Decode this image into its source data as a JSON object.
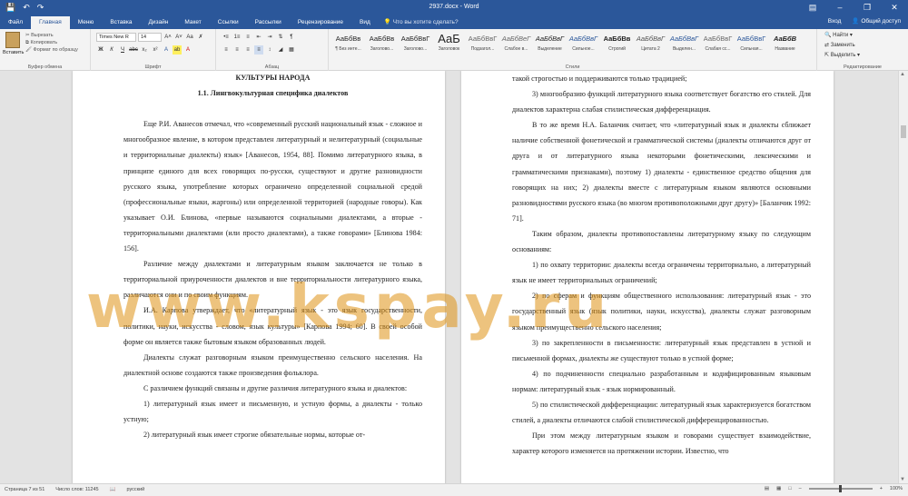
{
  "titlebar": {
    "doc_title": "2937.docx - Word",
    "qat": [
      "save-icon",
      "undo-icon",
      "redo-icon"
    ],
    "controls": [
      "minimize-icon",
      "restore-icon",
      "close-icon"
    ]
  },
  "tabs": [
    "Файл",
    "Главная",
    "Меню",
    "Вставка",
    "Дизайн",
    "Макет",
    "Ссылки",
    "Рассылки",
    "Рецензирование",
    "Вид"
  ],
  "tellme": "Что вы хотите сделать?",
  "tabs_right": {
    "signin": "Вход",
    "share": "Общий доступ"
  },
  "ribbon": {
    "clipboard": {
      "paste": "Вставить",
      "cut": "Вырезать",
      "copy": "Копировать",
      "format_painter": "Формат по образцу",
      "label": "Буфер обмена"
    },
    "font": {
      "name": "Times New R",
      "size": "14",
      "label": "Шрифт"
    },
    "paragraph": {
      "label": "Абзац"
    },
    "styles": {
      "label": "Стили",
      "items": [
        {
          "sample": "АаБбВв",
          "name": "¶ Без инте..."
        },
        {
          "sample": "АаБбВв",
          "name": "Заголово..."
        },
        {
          "sample": "АаБбВвГ",
          "name": "Заголово..."
        },
        {
          "sample": "АаБ",
          "name": "Заголовок"
        },
        {
          "sample": "АаБбВвГ",
          "name": "Подзагол..."
        },
        {
          "sample": "АаБбВеГ",
          "name": "Слабое в..."
        },
        {
          "sample": "АаБбВвГ",
          "name": "Выделение"
        },
        {
          "sample": "АаБбВвГ",
          "name": "Сильное..."
        },
        {
          "sample": "АаБбВв",
          "name": "Строгий"
        },
        {
          "sample": "АаБбВвГ",
          "name": "Цитата 2"
        },
        {
          "sample": "АаБбВвГ",
          "name": "Выделен..."
        },
        {
          "sample": "АаБбВвГ",
          "name": "Слабая сс..."
        },
        {
          "sample": "АаБбВвГ",
          "name": "Сильная..."
        },
        {
          "sample": "АаБбВ",
          "name": "Название"
        }
      ]
    },
    "editing": {
      "find": "Найти",
      "replace": "Заменить",
      "select": "Выделить",
      "label": "Редактирование"
    }
  },
  "page_left": {
    "lines": [
      {
        "text": "КУЛЬТУРЫ НАРОДА",
        "style": "ctr"
      },
      {
        "text": "1.1. Лингвокультурная специфика диалектов",
        "style": "ctr"
      },
      {
        "text": "",
        "style": ""
      },
      {
        "text": "Еще Р.И. Аванесов отмечал, что «современный русский национальный язык - сложное и многообразное явление, в котором представлен литературный и нелитературный (социальные и территориальные диалекты) язык» [Аванесов, 1954, 88]. Помимо литературного языка, в принципе единого для всех говорящих по-русски, существуют и другие разновидности русского языка, употребление которых ограничено определенной социальной средой (профессиональные языки, жаргоны) или определенной территорией (народные говоры). Как указывает О.И. Блинова, «первые называются социальными диалектами, а вторые - территориальными диалектами (или просто диалектами), а также говорами» [Блинова 1984: 156].",
        "style": "ind"
      },
      {
        "text": "Различие между диалектами и литературным языком заключается не только в территориальной приуроченности диалектов и вне территориальности литературного языка, различаются они и по своим функциям.",
        "style": "ind"
      },
      {
        "text": "И.А. Карпова утверждает, что «литературный язык - это язык государственности, политики, науки, искусства - словом, язык культуры» [Карпова 1994; 60]. В своей особой форме он является также бытовым языком образованных людей.",
        "style": "ind"
      },
      {
        "text": "Диалекты служат разговорным языком преимущественно сельского населения. На диалектной основе создаются также произведения фольклора.",
        "style": "ind"
      },
      {
        "text": "С различием функций связаны и другие различия литературного языка и диалектов:",
        "style": "ind"
      },
      {
        "text": "1) литературный язык имеет и письменную, и устную формы, а диалекты - только устную;",
        "style": "ind"
      },
      {
        "text": "2) литературный язык имеет строгие обязательные нормы, которые от-",
        "style": "ind"
      }
    ]
  },
  "page_right": {
    "lines": [
      {
        "text": "такой строгостью и поддерживаются только традицией;",
        "style": ""
      },
      {
        "text": "3) многообразию функций литературного языка соответствует богатство его стилей. Для диалектов характерна слабая стилистическая дифференциация.",
        "style": "ind"
      },
      {
        "text": "В то же время Н.А. Баланчик считает, что «литературный язык и диалекты сближает наличие собственной фонетической и грамматической системы (диалекты отличаются друг от друга и от литературного языка некоторыми фонетическими, лексическими и грамматическими признаками), поэтому 1) диалекты - единственное средство общения для говорящих на них; 2) диалекты вместе с литературным языком являются основными разновидностями русского языка (во многом противоположными друг другу)» [Баланчик 1992: 71].",
        "style": "ind"
      },
      {
        "text": "Таким образом, диалекты противопоставлены литературному языку по следующим основаниям:",
        "style": "ind"
      },
      {
        "text": "1) по охвату территории: диалекты всегда ограничены территориально, а литературный язык не имеет территориальных ограничений;",
        "style": "ind"
      },
      {
        "text": "2) по сферам и функциям общественного использования: литературный язык - это государственный язык (язык политики, науки, искусства), диалекты служат разговорным языком преимущественно сельского населения;",
        "style": "ind"
      },
      {
        "text": "3) по закрепленности в письменности: литературный язык представлен в устной и письменной формах, диалекты же существуют только в устной форме;",
        "style": "ind"
      },
      {
        "text": "4) по подчиненности специально разработанным и кодифицированным языковым нормам: литературный язык - язык нормированный.",
        "style": "ind"
      },
      {
        "text": "5) по стилистической дифференциации: литературный язык характеризуется богатством стилей, а диалекты отличаются слабой стилистической дифференцированностью.",
        "style": "ind"
      },
      {
        "text": "При этом между литературным языком и говорами существует взаимодействие, характер которого изменяется на протяжении истории. Известно, что",
        "style": "ind"
      }
    ]
  },
  "watermark": "www.kspay.ru",
  "statusbar": {
    "page": "Страница 7 из 51",
    "words": "Число слов: 11245",
    "lang": "русский",
    "zoom": "100%"
  }
}
